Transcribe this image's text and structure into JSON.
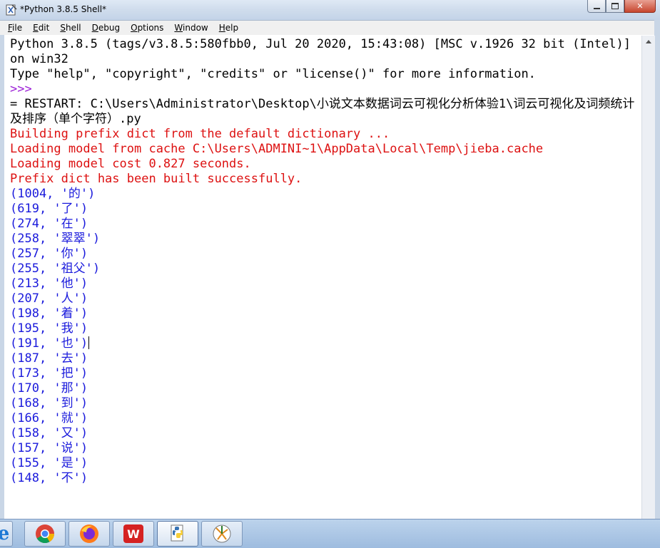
{
  "window": {
    "title": "*Python 3.8.5 Shell*",
    "controls": {
      "minimize": "▭",
      "maximize": "□",
      "close": "✕"
    }
  },
  "menu": {
    "items": [
      {
        "label": "File",
        "accel": "F",
        "rest": "ile"
      },
      {
        "label": "Edit",
        "accel": "E",
        "rest": "dit"
      },
      {
        "label": "Shell",
        "accel": "S",
        "rest": "hell"
      },
      {
        "label": "Debug",
        "accel": "D",
        "rest": "ebug"
      },
      {
        "label": "Options",
        "accel": "O",
        "rest": "ptions"
      },
      {
        "label": "Window",
        "accel": "W",
        "rest": "indow"
      },
      {
        "label": "Help",
        "accel": "H",
        "rest": "elp"
      }
    ]
  },
  "shell": {
    "banner": "Python 3.8.5 (tags/v3.8.5:580fbb0, Jul 20 2020, 15:43:08) [MSC v.1926 32 bit (Intel)] on win32",
    "info": "Type \"help\", \"copyright\", \"credits\" or \"license()\" for more information.",
    "prompt": ">>> ",
    "restart": "= RESTART: C:\\Users\\Administrator\\Desktop\\小说文本数据词云可视化分析体验1\\词云可视化及词频统计及排序（单个字符）.py",
    "stderr": [
      "Building prefix dict from the default dictionary ...",
      "Loading model from cache C:\\Users\\ADMINI~1\\AppData\\Local\\Temp\\jieba.cache",
      "Loading model cost 0.827 seconds.",
      "Prefix dict has been built successfully."
    ],
    "output": [
      "(1004, '的')",
      "(619, '了')",
      "(274, '在')",
      "(258, '翠翠')",
      "(257, '你')",
      "(255, '祖父')",
      "(213, '他')",
      "(207, '人')",
      "(198, '着')",
      "(195, '我')",
      "(191, '也')",
      "(187, '去')",
      "(173, '把')",
      "(170, '那')",
      "(168, '到')",
      "(166, '就')",
      "(158, '又')",
      "(157, '说')",
      "(155, '是')",
      "(148, '不')"
    ]
  },
  "taskbar": {
    "items": [
      {
        "name": "ie-icon",
        "label": "e"
      },
      {
        "name": "chrome-icon",
        "label": ""
      },
      {
        "name": "firefox-icon",
        "label": ""
      },
      {
        "name": "wps-icon",
        "label": "W"
      },
      {
        "name": "python-icon",
        "label": ""
      },
      {
        "name": "idle-icon",
        "label": ""
      }
    ]
  }
}
